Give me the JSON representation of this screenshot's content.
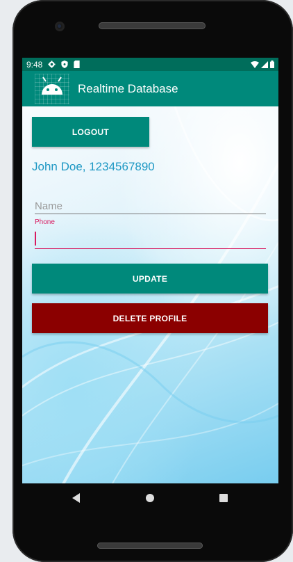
{
  "status_bar": {
    "time": "9:48"
  },
  "app_bar": {
    "title": "Realtime Database"
  },
  "main": {
    "logout_label": "LOGOUT",
    "user_info": "John Doe, 1234567890",
    "name_placeholder": "Name",
    "phone_label": "Phone",
    "phone_value": "",
    "update_label": "UPDATE",
    "delete_label": "DELETE PROFILE"
  },
  "colors": {
    "primary": "#00897b",
    "primary_dark": "#006d5b",
    "delete": "#8b0000",
    "accent": "#d81b60",
    "user_text": "#1e98c4"
  },
  "icons": [
    "settings-icon",
    "shield-icon",
    "sim-icon",
    "wifi-icon",
    "signal-icon",
    "battery-icon",
    "android-icon",
    "back-icon",
    "home-icon",
    "recents-icon"
  ]
}
